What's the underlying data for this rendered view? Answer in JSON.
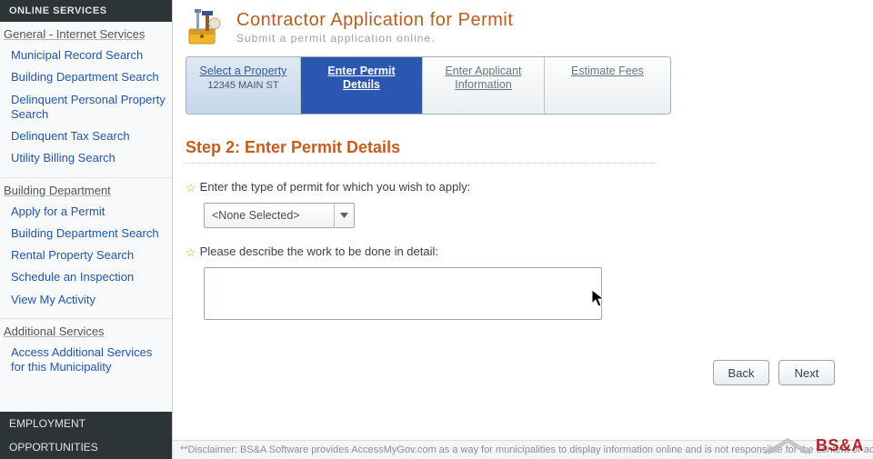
{
  "sidebar": {
    "header": "ONLINE SERVICES",
    "sections": [
      {
        "title": "General - Internet Services",
        "items": [
          "Municipal Record Search",
          "Building Department Search",
          "Delinquent Personal Property Search",
          "Delinquent Tax Search",
          "Utility Billing Search"
        ]
      },
      {
        "title": "Building Department",
        "items": [
          "Apply for a Permit",
          "Building Department Search",
          "Rental Property Search",
          "Schedule an Inspection",
          "View My Activity"
        ]
      },
      {
        "title": "Additional Services",
        "items": [
          "Access Additional Services for this Municipality"
        ]
      }
    ],
    "footer": [
      "EMPLOYMENT",
      "OPPORTUNITIES"
    ]
  },
  "header": {
    "title": "Contractor Application for Permit",
    "subtitle": "Submit a permit application online."
  },
  "wizard": {
    "steps": [
      {
        "label": "Select a Property",
        "sub": "12345 MAIN ST"
      },
      {
        "label": "Enter Permit Details"
      },
      {
        "label": "Enter Applicant Information"
      },
      {
        "label": "Estimate Fees"
      }
    ],
    "current_index": 1
  },
  "section_heading": "Step 2: Enter Permit Details",
  "fields": {
    "permit_type": {
      "label": "Enter the type of permit for which you wish to apply:",
      "selected": "<None Selected>"
    },
    "work_description": {
      "label": "Please describe the work to be done in detail:",
      "value": ""
    }
  },
  "buttons": {
    "back": "Back",
    "next": "Next"
  },
  "disclaimer": "**Disclaimer: BS&A Software provides AccessMyGov.com as a way for municipalities to display information online and is not responsible for the content or ac",
  "brand": "BS&A"
}
